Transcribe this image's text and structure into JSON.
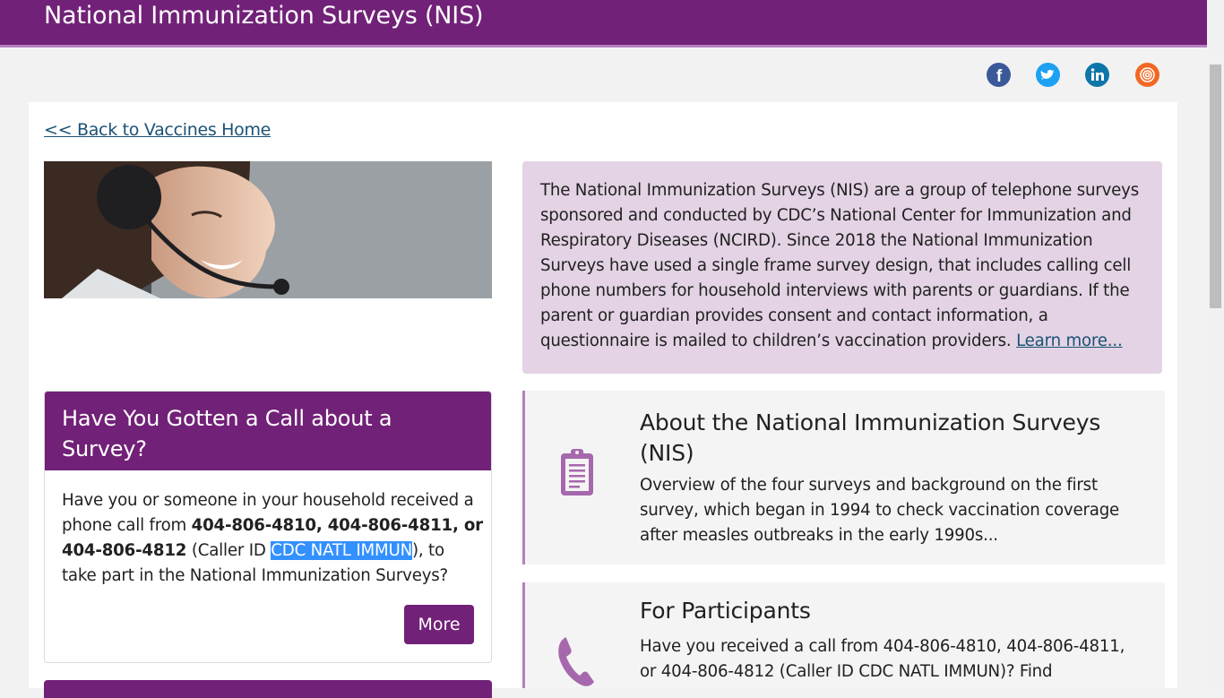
{
  "header": {
    "title": "National Immunization Surveys (NIS)"
  },
  "social": [
    {
      "name": "facebook-icon",
      "color": "#3b5998"
    },
    {
      "name": "twitter-icon",
      "color": "#1da1f2"
    },
    {
      "name": "linkedin-icon",
      "color": "#0e76a8"
    },
    {
      "name": "syndicate-icon",
      "color": "#f26722"
    }
  ],
  "back_link": "<< Back to Vaccines Home",
  "intro": {
    "text": "The National Immunization Surveys (NIS) are a group of telephone surveys sponsored and conducted by CDC’s National Center for Immunization and Respiratory Diseases (NCIRD). Since 2018 the National Immunization Surveys have used a single frame survey design, that includes calling cell phone numbers for household interviews with parents or guardians. If the parent or guardian provides consent and contact information, a questionnaire is mailed to children’s vaccination providers. ",
    "link": "Learn more..."
  },
  "call_card": {
    "title": "Have You Gotten a Call about a Survey?",
    "text_1": "Have you or someone in your household received a phone call from ",
    "phones": "404-806-4810, 404-806-4811, or 404-806-4812",
    "text_2": " (Caller ID ",
    "caller_id": "CDC NATL IMMUN",
    "text_3": "), to take part in the National Immunization Surveys?",
    "button": "More"
  },
  "features": [
    {
      "title": "About the National Immunization Surveys (NIS)",
      "text": "Overview of the four surveys and background on the first survey, which began in 1994 to check vaccination coverage after measles outbreaks in the early 1990s...",
      "icon": "clipboard-icon"
    },
    {
      "title": "For Participants",
      "text": "Have you received a call from 404-806-4810, 404-806-4811, or 404-806-4812 (Caller ID CDC NATL IMMUN)? Find information",
      "icon": "phone-icon"
    }
  ],
  "colors": {
    "brand": "#712177",
    "accent_light": "#e3d3e4",
    "border_accent": "#b77fbf",
    "selection": "#3390ff"
  }
}
